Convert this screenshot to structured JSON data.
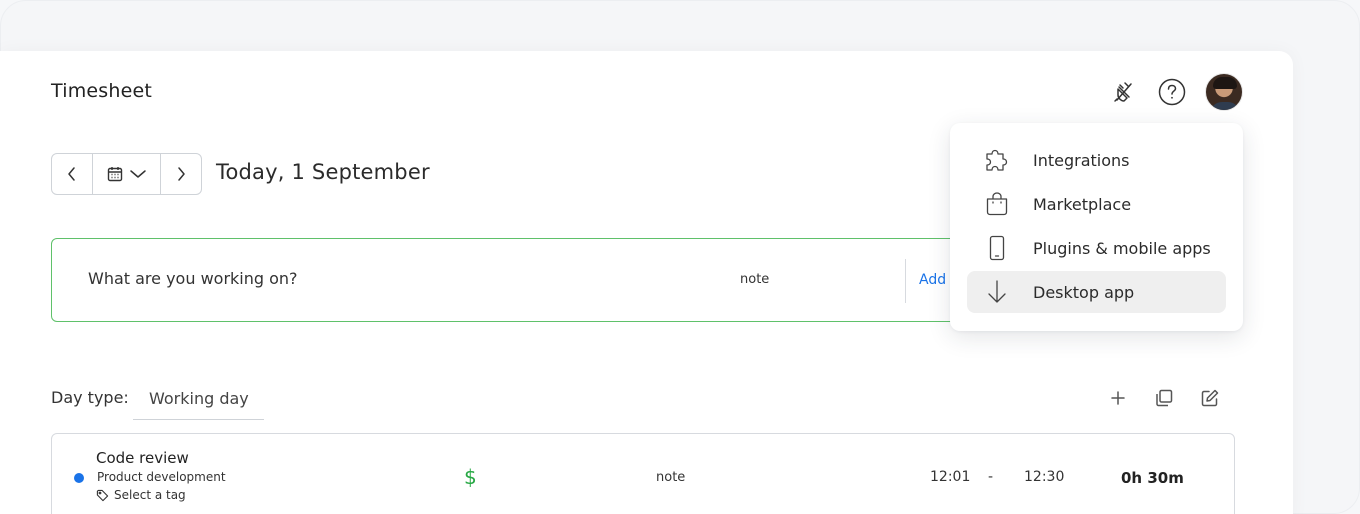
{
  "header": {
    "title": "Timesheet",
    "icons": [
      "integrations-plug-icon",
      "help-icon",
      "avatar"
    ]
  },
  "date_nav": {
    "date_label": "Today, 1 September"
  },
  "entry_bar": {
    "placeholder": "What are you working on?",
    "note": "note",
    "add_label": "Add"
  },
  "day_type": {
    "label": "Day type:",
    "value": "Working day"
  },
  "entries": [
    {
      "description": "Code review",
      "project": "Product development",
      "project_color": "#1a73e8",
      "tag": "Select a tag",
      "billable_symbol": "$",
      "note": "note",
      "start": "12:01",
      "dash": "-",
      "end": "12:30",
      "duration": "0h 30m"
    }
  ],
  "menu": {
    "items": [
      {
        "label": "Integrations",
        "icon": "puzzle-icon"
      },
      {
        "label": "Marketplace",
        "icon": "shopping-bag-icon"
      },
      {
        "label": "Plugins & mobile apps",
        "icon": "mobile-phone-icon"
      },
      {
        "label": "Desktop app",
        "icon": "download-arrow-icon",
        "active": true
      }
    ]
  },
  "colors": {
    "accent": "#1a73e8",
    "success": "#27a844",
    "input_border": "#5fc16a"
  }
}
